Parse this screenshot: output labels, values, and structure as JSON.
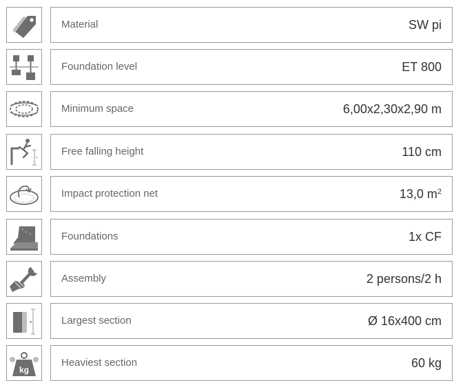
{
  "specs": [
    {
      "label": "Material",
      "value": "SW pi",
      "icon": "tag-icon"
    },
    {
      "label": "Foundation level",
      "value": "ET 800",
      "icon": "foundation-level-icon"
    },
    {
      "label": "Minimum space",
      "value": "6,00x2,30x2,90 m",
      "icon": "minimum-space-icon"
    },
    {
      "label": "Free falling height",
      "value": "110 cm",
      "icon": "falling-person-icon"
    },
    {
      "label": "Impact protection net",
      "value": "13,0 m",
      "value_sup": "2",
      "icon": "impact-net-icon"
    },
    {
      "label": "Foundations",
      "value": "1x CF",
      "icon": "concrete-foundation-icon"
    },
    {
      "label": "Assembly",
      "value": "2 persons/2 h",
      "icon": "wrench-hand-icon"
    },
    {
      "label": "Largest section",
      "value": "Ø 16x400 cm",
      "icon": "largest-section-icon"
    },
    {
      "label": "Heaviest section",
      "value": "60 kg",
      "icon": "weight-icon"
    }
  ],
  "icon_text": {
    "kg": "kg"
  },
  "colors": {
    "border": "#9a9a9a",
    "icon_fill": "#6e6e6e",
    "label_text": "#666666",
    "value_text": "#333333"
  }
}
